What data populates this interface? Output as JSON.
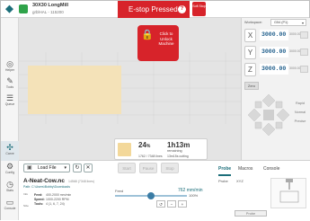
{
  "header": {
    "machine_name": "30X30 LongMill",
    "port": "grblHAL - 115200",
    "estop_title": "E-stop Pressed",
    "estop_help": "?",
    "estop_button": "Soft Stop"
  },
  "sidebar": {
    "items": [
      {
        "label": "Helper",
        "icon": "helper-icon"
      },
      {
        "label": "Tools",
        "icon": "tools-icon"
      },
      {
        "label": "Queue",
        "icon": "queue-icon"
      },
      {
        "label": "Carve",
        "icon": "carve-icon"
      },
      {
        "label": "Config",
        "icon": "config-icon"
      },
      {
        "label": "Stats",
        "icon": "stats-icon"
      },
      {
        "label": "Console",
        "icon": "console-icon"
      }
    ]
  },
  "viz": {
    "unlock_text": "Click to Unlock Machine",
    "progress_percent": "24",
    "percent_sign": "%",
    "lines": "1762 / 7348 lines",
    "time": "1h13m",
    "remaining": "remaining",
    "cutting": "13m15s cutting"
  },
  "right": {
    "workspace_label": "Workspace:",
    "workspace_value": "G54 (P1)",
    "axes": [
      {
        "label": "X",
        "value": "3000.00",
        "unit": "3000.00"
      },
      {
        "label": "Y",
        "value": "3000.00",
        "unit": "3000.00"
      },
      {
        "label": "Z",
        "value": "3000.00",
        "unit": "3000.00"
      }
    ],
    "zero_label": "Zero",
    "speeds": [
      "Rapid",
      "Normal",
      "Precise"
    ]
  },
  "bottom": {
    "load_file": "Load File",
    "controls": [
      "Start",
      "Pause",
      "Stop"
    ],
    "tabs": [
      "Probe",
      "Macros",
      "Console"
    ],
    "file_name": "A-Neat-Cow.nc",
    "file_size": "14568 (7348 lines)",
    "file_path": "Path: C:\\Users\\Bobby\\Downloads",
    "info_label": "Info",
    "size_label": "Size",
    "feed_label": "Feed:",
    "feed_value": "400-2000 mm/min",
    "speed_label": "Speed:",
    "speed_value": "1000-2200 RPM",
    "tools_label": "Tools:",
    "tools_value": "4 (1, 6, 7, 24)",
    "feedrate_label": "Feed",
    "feedrate_value": "762 mm/min",
    "feedrate_percent": "100%",
    "probe_label": "Probe",
    "probe_axes": "XYZ",
    "probe_button": "Probe"
  },
  "colors": {
    "estop_red": "#d7232a",
    "accent_teal": "#1c6e7a",
    "position_blue": "#1c5c8a"
  }
}
